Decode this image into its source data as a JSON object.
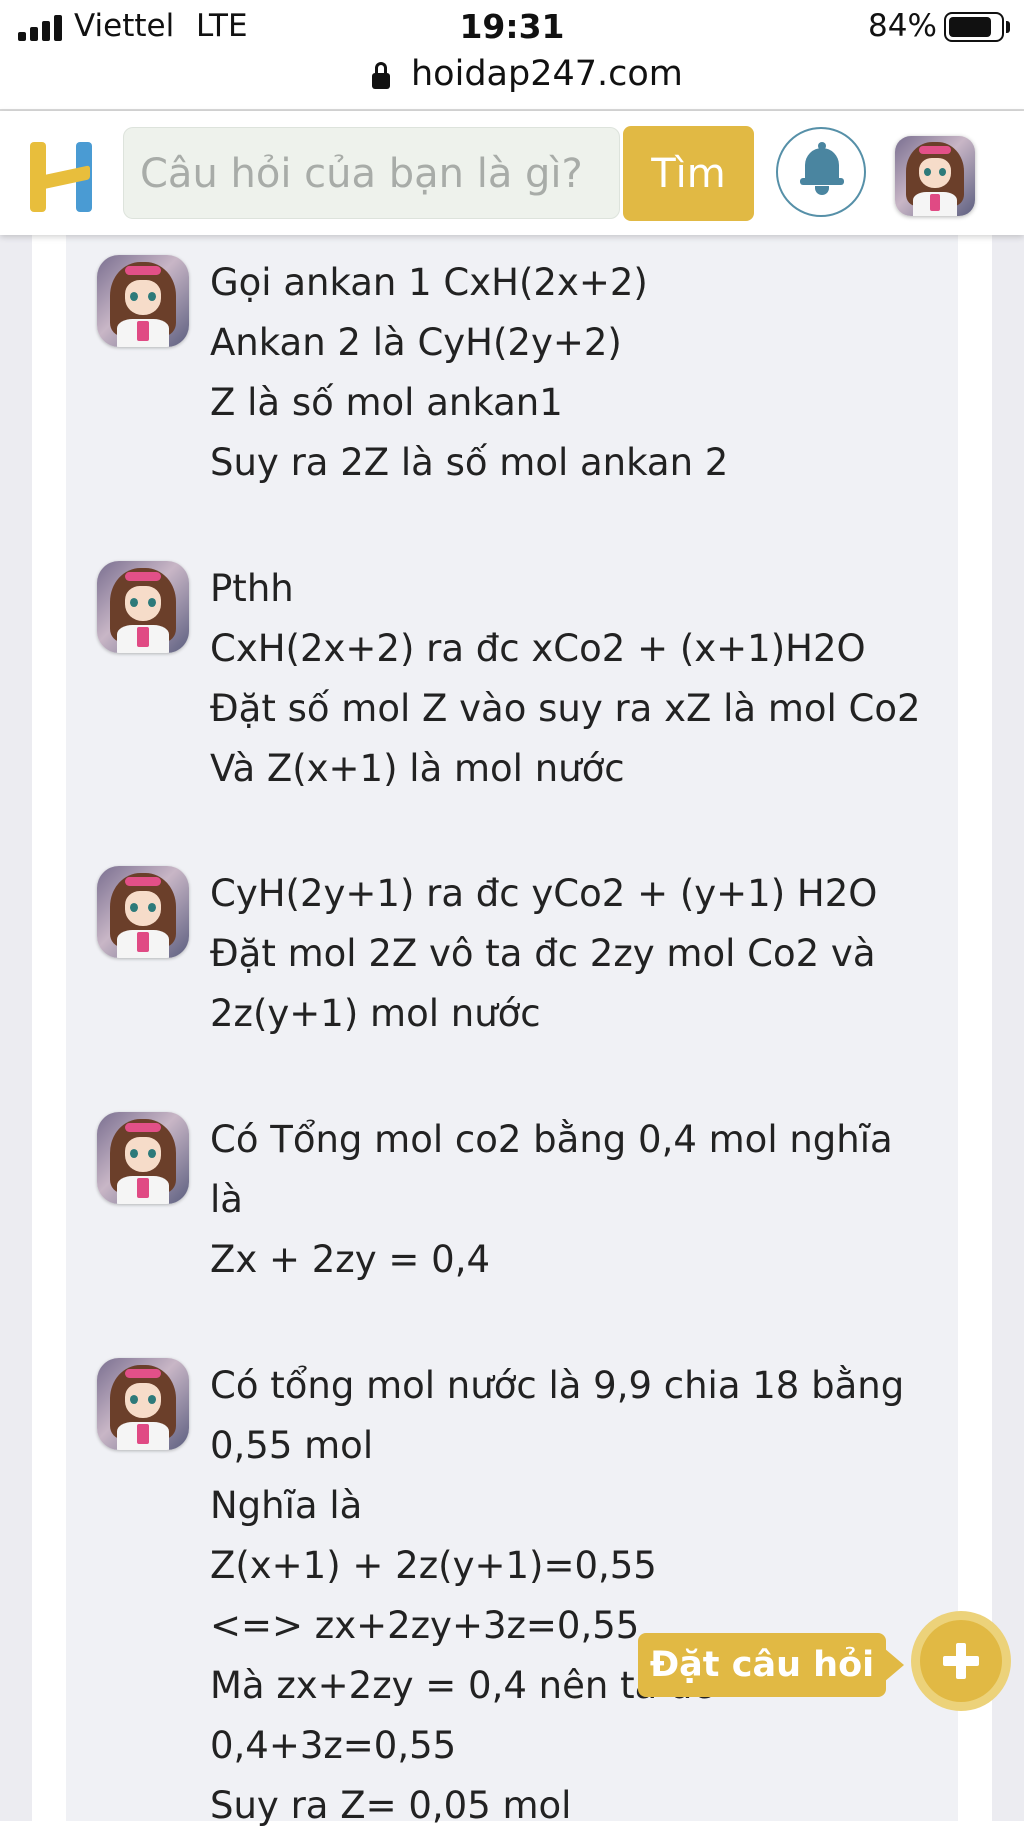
{
  "status_bar": {
    "carrier": "Viettel",
    "network": "LTE",
    "time": "19:31",
    "battery": "84%",
    "battery_level": 0.84
  },
  "browser": {
    "url": "hoidap247.com"
  },
  "header": {
    "search_placeholder": "Câu hỏi của bạn là gì?",
    "search_button": "Tìm"
  },
  "comments": [
    {
      "lines": [
        "Gọi ankan 1 CxH(2x+2)",
        "Ankan 2 là CyH(2y+2)",
        "Z là số mol ankan1",
        "Suy ra 2Z là số mol ankan 2"
      ]
    },
    {
      "lines": [
        "Pthh",
        "CxH(2x+2) ra đc xCo2 + (x+1)H2O",
        "Đặt số mol Z vào suy ra xZ là mol Co2",
        "Và Z(x+1) là mol nước"
      ]
    },
    {
      "lines": [
        "CyH(2y+1) ra đc yCo2 + (y+1) H2O",
        "Đặt mol 2Z vô ta đc 2zy mol Co2 và",
        "2z(y+1) mol nước"
      ]
    },
    {
      "lines": [
        "Có Tổng mol co2 bằng 0,4 mol nghĩa",
        "là",
        "Zx + 2zy = 0,4"
      ]
    },
    {
      "lines": [
        "Có tổng mol nước là 9,9 chia 18 bằng",
        "0,55 mol",
        "Nghĩa là",
        "Z(x+1) + 2z(y+1)=0,55",
        "<=> zx+2zy+3z=0,55",
        "Mà zx+2zy = 0,4 nên ta đc",
        "0,4+3z=0,55",
        "Suy ra Z= 0,05 mol"
      ]
    }
  ],
  "fab": {
    "label": "Đặt câu hỏi"
  },
  "colors": {
    "accent": "#e1b944",
    "blue": "#4a9bd3",
    "bell": "#4a85a0"
  }
}
